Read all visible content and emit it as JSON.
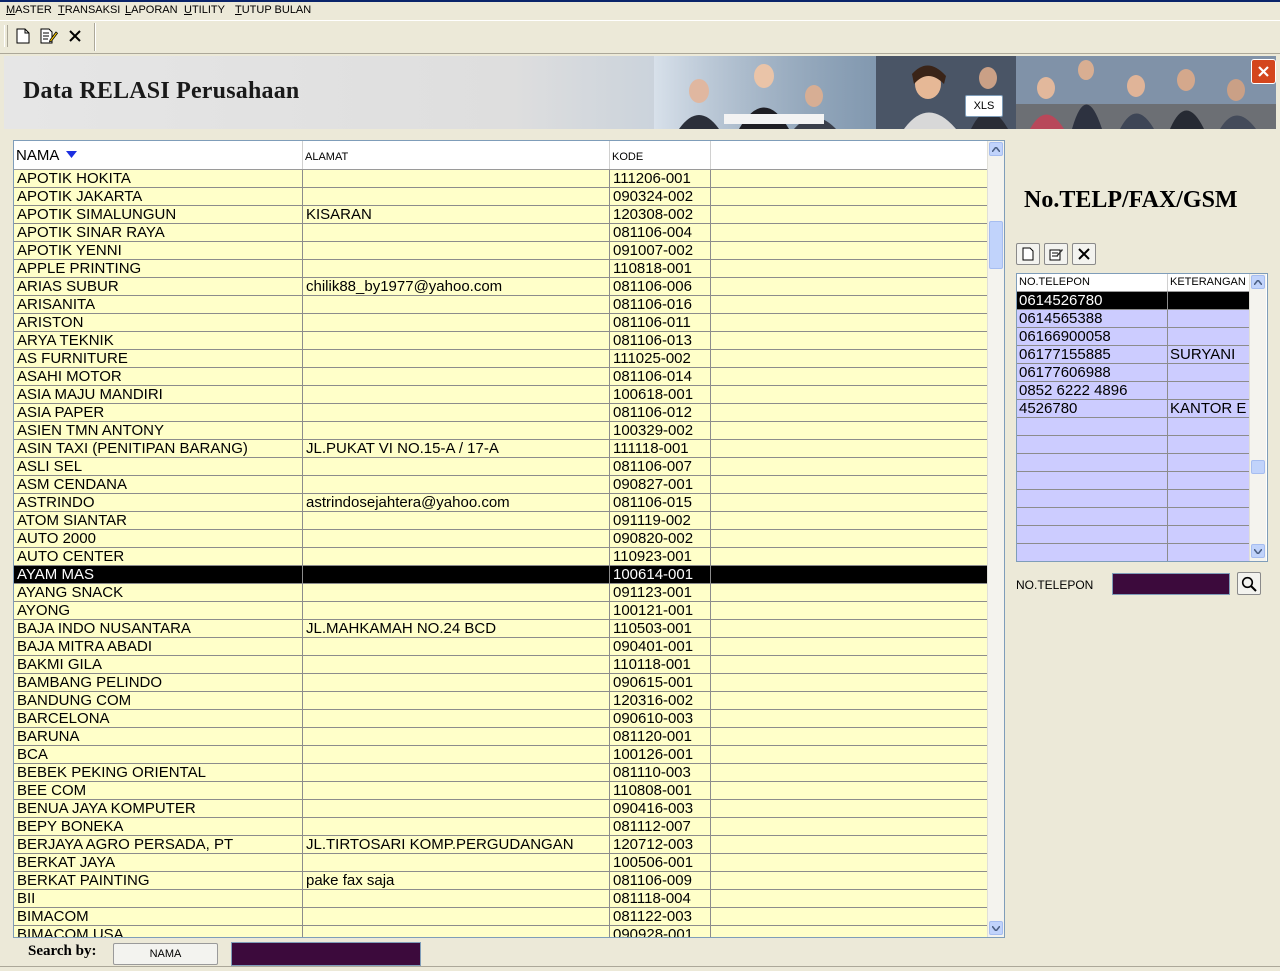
{
  "menu": [
    "MASTER",
    "TRANSAKSI",
    "LAPORAN",
    "UTILITY",
    "TUTUP BULAN"
  ],
  "banner": {
    "title": "Data RELASI Perusahaan",
    "xls_label": "XLS"
  },
  "grid": {
    "columns": [
      "NAMA",
      "ALAMAT",
      "KODE",
      ""
    ],
    "rows": [
      [
        "APOTIK HOKITA",
        "",
        "111206-001"
      ],
      [
        "APOTIK JAKARTA",
        "",
        "090324-002"
      ],
      [
        "APOTIK SIMALUNGUN",
        "KISARAN",
        "120308-002"
      ],
      [
        "APOTIK SINAR RAYA",
        "",
        "081106-004"
      ],
      [
        "APOTIK YENNI",
        "",
        "091007-002"
      ],
      [
        "APPLE PRINTING",
        "",
        "110818-001"
      ],
      [
        "ARIAS SUBUR",
        "chilik88_by1977@yahoo.com",
        "081106-006"
      ],
      [
        "ARISANITA",
        "",
        "081106-016"
      ],
      [
        "ARISTON",
        "",
        "081106-011"
      ],
      [
        "ARYA TEKNIK",
        "",
        "081106-013"
      ],
      [
        "AS FURNITURE",
        "",
        "111025-002"
      ],
      [
        "ASAHI MOTOR",
        "",
        "081106-014"
      ],
      [
        "ASIA MAJU MANDIRI",
        "",
        "100618-001"
      ],
      [
        "ASIA PAPER",
        "",
        "081106-012"
      ],
      [
        "ASIEN TMN ANTONY",
        "",
        "100329-002"
      ],
      [
        "ASIN TAXI (PENITIPAN BARANG)",
        "JL.PUKAT VI NO.15-A / 17-A",
        "111118-001"
      ],
      [
        "ASLI SEL",
        "",
        "081106-007"
      ],
      [
        "ASM CENDANA",
        "",
        "090827-001"
      ],
      [
        "ASTRINDO",
        "astrindosejahtera@yahoo.com",
        "081106-015"
      ],
      [
        "ATOM SIANTAR",
        "",
        "091119-002"
      ],
      [
        "AUTO 2000",
        "",
        "090820-002"
      ],
      [
        "AUTO CENTER",
        "",
        "110923-001"
      ],
      [
        "AYAM MAS",
        "",
        "100614-001"
      ],
      [
        "AYANG SNACK",
        "",
        "091123-001"
      ],
      [
        "AYONG",
        "",
        "100121-001"
      ],
      [
        "BAJA INDO NUSANTARA",
        "JL.MAHKAMAH NO.24 BCD",
        "110503-001"
      ],
      [
        "BAJA MITRA ABADI",
        "",
        "090401-001"
      ],
      [
        "BAKMI GILA",
        "",
        "110118-001"
      ],
      [
        "BAMBANG PELINDO",
        "",
        "090615-001"
      ],
      [
        "BANDUNG COM",
        "",
        "120316-002"
      ],
      [
        "BARCELONA",
        "",
        "090610-003"
      ],
      [
        "BARUNA",
        "",
        "081120-001"
      ],
      [
        "BCA",
        "",
        "100126-001"
      ],
      [
        "BEBEK PEKING ORIENTAL",
        "",
        "081110-003"
      ],
      [
        "BEE COM",
        "",
        "110808-001"
      ],
      [
        "BENUA JAYA KOMPUTER",
        "",
        "090416-003"
      ],
      [
        "BEPY BONEKA",
        "",
        "081112-007"
      ],
      [
        "BERJAYA AGRO PERSADA, PT",
        "JL.TIRTOSARI KOMP.PERGUDANGAN",
        "120712-003"
      ],
      [
        "BERKAT JAYA",
        "",
        "100506-001"
      ],
      [
        "BERKAT PAINTING",
        "pake fax saja",
        "081106-009"
      ],
      [
        "BII",
        "",
        "081118-004"
      ],
      [
        "BIMACOM",
        "",
        "081122-003"
      ],
      [
        "BIMACOM USA",
        "",
        "090928-001"
      ]
    ],
    "selected_index": 22
  },
  "search": {
    "label": "Search by:",
    "field_button": "NAMA",
    "value": ""
  },
  "phones": {
    "title": "No.TELP/FAX/GSM",
    "columns": [
      "NO.TELEPON",
      "KETERANGAN"
    ],
    "rows": [
      [
        "0614526780",
        ""
      ],
      [
        "0614565388",
        ""
      ],
      [
        "06166900058",
        ""
      ],
      [
        "06177155885",
        "SURYANI"
      ],
      [
        "06177606988",
        ""
      ],
      [
        "0852 6222 4896",
        ""
      ],
      [
        "4526780",
        "KANTOR E"
      ]
    ],
    "selected_index": 0,
    "empty_rows": 8,
    "search_label": "NO.TELEPON",
    "search_value": ""
  },
  "colors": {
    "row_bg": "#ffffc9",
    "phone_row_bg": "#ccccff",
    "input_bg": "#3c0a3c",
    "selected": "#000000"
  }
}
